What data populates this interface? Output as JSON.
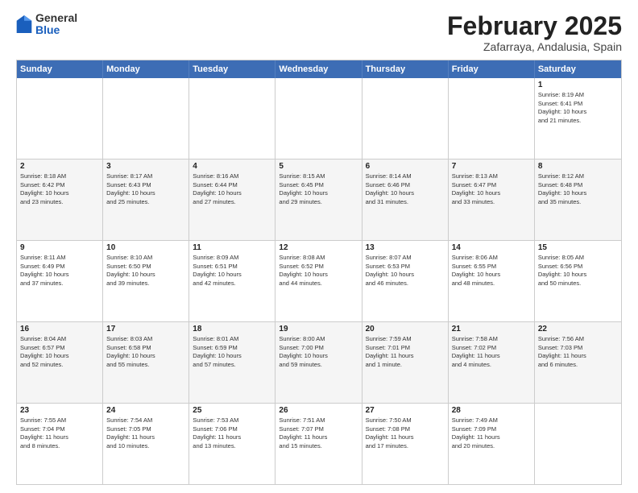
{
  "logo": {
    "line1": "General",
    "line2": "Blue"
  },
  "title": "February 2025",
  "subtitle": "Zafarraya, Andalusia, Spain",
  "header_days": [
    "Sunday",
    "Monday",
    "Tuesday",
    "Wednesday",
    "Thursday",
    "Friday",
    "Saturday"
  ],
  "weeks": [
    {
      "alt": false,
      "days": [
        {
          "num": "",
          "lines": []
        },
        {
          "num": "",
          "lines": []
        },
        {
          "num": "",
          "lines": []
        },
        {
          "num": "",
          "lines": []
        },
        {
          "num": "",
          "lines": []
        },
        {
          "num": "",
          "lines": []
        },
        {
          "num": "1",
          "lines": [
            "Sunrise: 8:19 AM",
            "Sunset: 6:41 PM",
            "Daylight: 10 hours",
            "and 21 minutes."
          ]
        }
      ]
    },
    {
      "alt": true,
      "days": [
        {
          "num": "2",
          "lines": [
            "Sunrise: 8:18 AM",
            "Sunset: 6:42 PM",
            "Daylight: 10 hours",
            "and 23 minutes."
          ]
        },
        {
          "num": "3",
          "lines": [
            "Sunrise: 8:17 AM",
            "Sunset: 6:43 PM",
            "Daylight: 10 hours",
            "and 25 minutes."
          ]
        },
        {
          "num": "4",
          "lines": [
            "Sunrise: 8:16 AM",
            "Sunset: 6:44 PM",
            "Daylight: 10 hours",
            "and 27 minutes."
          ]
        },
        {
          "num": "5",
          "lines": [
            "Sunrise: 8:15 AM",
            "Sunset: 6:45 PM",
            "Daylight: 10 hours",
            "and 29 minutes."
          ]
        },
        {
          "num": "6",
          "lines": [
            "Sunrise: 8:14 AM",
            "Sunset: 6:46 PM",
            "Daylight: 10 hours",
            "and 31 minutes."
          ]
        },
        {
          "num": "7",
          "lines": [
            "Sunrise: 8:13 AM",
            "Sunset: 6:47 PM",
            "Daylight: 10 hours",
            "and 33 minutes."
          ]
        },
        {
          "num": "8",
          "lines": [
            "Sunrise: 8:12 AM",
            "Sunset: 6:48 PM",
            "Daylight: 10 hours",
            "and 35 minutes."
          ]
        }
      ]
    },
    {
      "alt": false,
      "days": [
        {
          "num": "9",
          "lines": [
            "Sunrise: 8:11 AM",
            "Sunset: 6:49 PM",
            "Daylight: 10 hours",
            "and 37 minutes."
          ]
        },
        {
          "num": "10",
          "lines": [
            "Sunrise: 8:10 AM",
            "Sunset: 6:50 PM",
            "Daylight: 10 hours",
            "and 39 minutes."
          ]
        },
        {
          "num": "11",
          "lines": [
            "Sunrise: 8:09 AM",
            "Sunset: 6:51 PM",
            "Daylight: 10 hours",
            "and 42 minutes."
          ]
        },
        {
          "num": "12",
          "lines": [
            "Sunrise: 8:08 AM",
            "Sunset: 6:52 PM",
            "Daylight: 10 hours",
            "and 44 minutes."
          ]
        },
        {
          "num": "13",
          "lines": [
            "Sunrise: 8:07 AM",
            "Sunset: 6:53 PM",
            "Daylight: 10 hours",
            "and 46 minutes."
          ]
        },
        {
          "num": "14",
          "lines": [
            "Sunrise: 8:06 AM",
            "Sunset: 6:55 PM",
            "Daylight: 10 hours",
            "and 48 minutes."
          ]
        },
        {
          "num": "15",
          "lines": [
            "Sunrise: 8:05 AM",
            "Sunset: 6:56 PM",
            "Daylight: 10 hours",
            "and 50 minutes."
          ]
        }
      ]
    },
    {
      "alt": true,
      "days": [
        {
          "num": "16",
          "lines": [
            "Sunrise: 8:04 AM",
            "Sunset: 6:57 PM",
            "Daylight: 10 hours",
            "and 52 minutes."
          ]
        },
        {
          "num": "17",
          "lines": [
            "Sunrise: 8:03 AM",
            "Sunset: 6:58 PM",
            "Daylight: 10 hours",
            "and 55 minutes."
          ]
        },
        {
          "num": "18",
          "lines": [
            "Sunrise: 8:01 AM",
            "Sunset: 6:59 PM",
            "Daylight: 10 hours",
            "and 57 minutes."
          ]
        },
        {
          "num": "19",
          "lines": [
            "Sunrise: 8:00 AM",
            "Sunset: 7:00 PM",
            "Daylight: 10 hours",
            "and 59 minutes."
          ]
        },
        {
          "num": "20",
          "lines": [
            "Sunrise: 7:59 AM",
            "Sunset: 7:01 PM",
            "Daylight: 11 hours",
            "and 1 minute."
          ]
        },
        {
          "num": "21",
          "lines": [
            "Sunrise: 7:58 AM",
            "Sunset: 7:02 PM",
            "Daylight: 11 hours",
            "and 4 minutes."
          ]
        },
        {
          "num": "22",
          "lines": [
            "Sunrise: 7:56 AM",
            "Sunset: 7:03 PM",
            "Daylight: 11 hours",
            "and 6 minutes."
          ]
        }
      ]
    },
    {
      "alt": false,
      "days": [
        {
          "num": "23",
          "lines": [
            "Sunrise: 7:55 AM",
            "Sunset: 7:04 PM",
            "Daylight: 11 hours",
            "and 8 minutes."
          ]
        },
        {
          "num": "24",
          "lines": [
            "Sunrise: 7:54 AM",
            "Sunset: 7:05 PM",
            "Daylight: 11 hours",
            "and 10 minutes."
          ]
        },
        {
          "num": "25",
          "lines": [
            "Sunrise: 7:53 AM",
            "Sunset: 7:06 PM",
            "Daylight: 11 hours",
            "and 13 minutes."
          ]
        },
        {
          "num": "26",
          "lines": [
            "Sunrise: 7:51 AM",
            "Sunset: 7:07 PM",
            "Daylight: 11 hours",
            "and 15 minutes."
          ]
        },
        {
          "num": "27",
          "lines": [
            "Sunrise: 7:50 AM",
            "Sunset: 7:08 PM",
            "Daylight: 11 hours",
            "and 17 minutes."
          ]
        },
        {
          "num": "28",
          "lines": [
            "Sunrise: 7:49 AM",
            "Sunset: 7:09 PM",
            "Daylight: 11 hours",
            "and 20 minutes."
          ]
        },
        {
          "num": "",
          "lines": []
        }
      ]
    }
  ]
}
